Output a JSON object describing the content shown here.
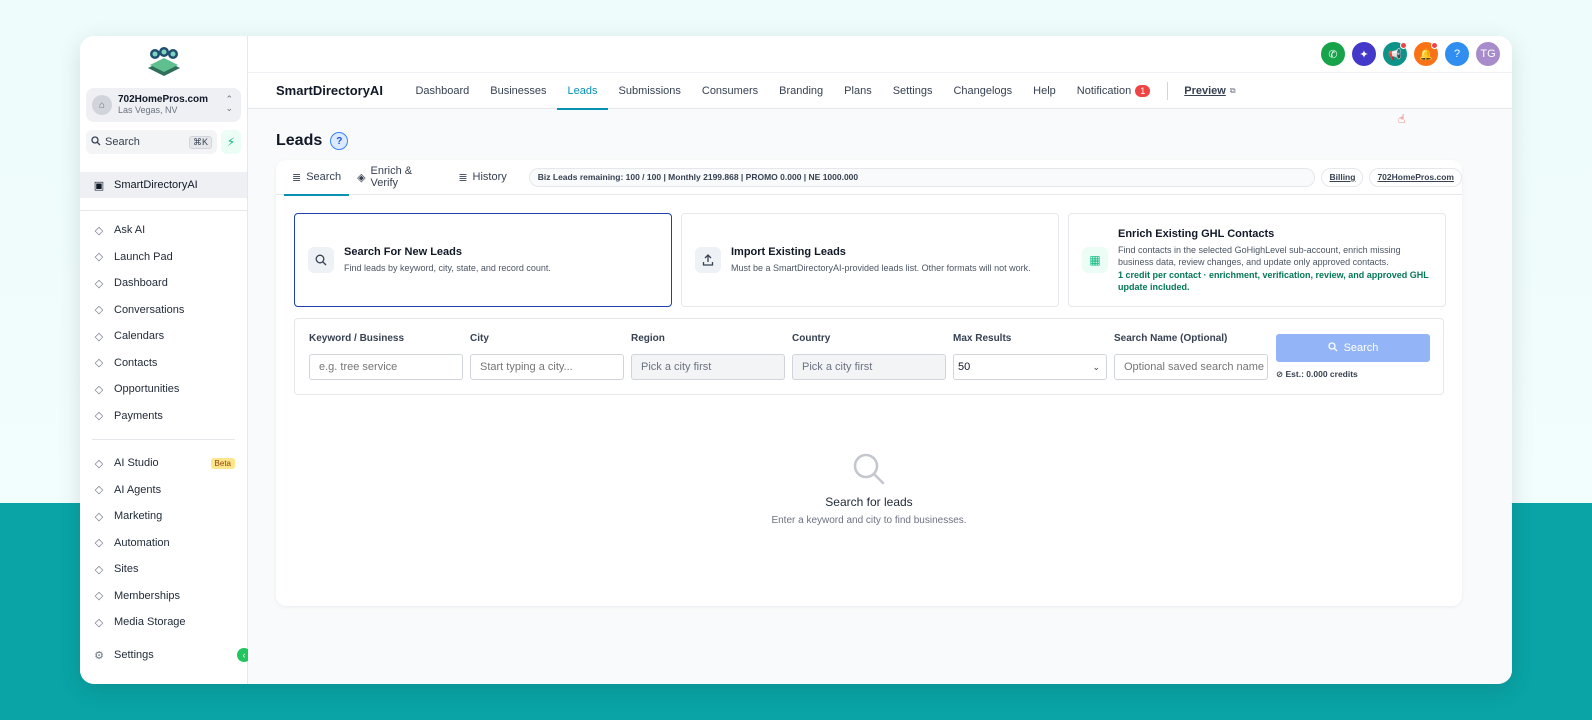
{
  "sidebar": {
    "account_name": "702HomePros.com",
    "account_location": "Las Vegas, NV",
    "search_label": "Search",
    "search_shortcut": "⌘K",
    "active_item": "SmartDirectoryAI",
    "items_primary": [
      {
        "label": "Ask AI",
        "icon": "sparkle-icon"
      },
      {
        "label": "Launch Pad",
        "icon": "rocket-icon"
      },
      {
        "label": "Dashboard",
        "icon": "grid-icon"
      },
      {
        "label": "Conversations",
        "icon": "chat-icon"
      },
      {
        "label": "Calendars",
        "icon": "calendar-icon"
      },
      {
        "label": "Contacts",
        "icon": "contacts-icon"
      },
      {
        "label": "Opportunities",
        "icon": "opportunities-icon"
      },
      {
        "label": "Payments",
        "icon": "payments-icon"
      }
    ],
    "items_secondary": [
      {
        "label": "AI Studio",
        "icon": "ai-studio-icon",
        "badge": "Beta"
      },
      {
        "label": "AI Agents",
        "icon": "ai-agents-icon"
      },
      {
        "label": "Marketing",
        "icon": "send-icon"
      },
      {
        "label": "Automation",
        "icon": "automation-icon"
      },
      {
        "label": "Sites",
        "icon": "sites-icon"
      },
      {
        "label": "Memberships",
        "icon": "membership-icon"
      },
      {
        "label": "Media Storage",
        "icon": "media-icon"
      }
    ],
    "settings_label": "Settings"
  },
  "topbar": {
    "avatar_initials": "TG",
    "colors": {
      "phone": "#16a34a",
      "ai": "#4338ca",
      "megaphone": "#0d9488",
      "bell": "#f97316",
      "help": "#2f8ef0",
      "avatar": "#a78bca"
    }
  },
  "nav": {
    "brand": "SmartDirectoryAI",
    "tabs": [
      "Dashboard",
      "Businesses",
      "Leads",
      "Submissions",
      "Consumers",
      "Branding",
      "Plans",
      "Settings",
      "Changelogs",
      "Help"
    ],
    "active_tab": "Leads",
    "notification_label": "Notification",
    "notification_count": "1",
    "preview_label": "Preview"
  },
  "page": {
    "title": "Leads",
    "help": "?"
  },
  "subtabs": {
    "search": "Search",
    "enrich": "Enrich & Verify",
    "history": "History",
    "quota": "Biz Leads remaining: 100 / 100 | Monthly 2199.868 | PROMO 0.000 | NE 1000.000",
    "billing": "Billing",
    "domain": "702HomePros.com"
  },
  "options": [
    {
      "title": "Search For New Leads",
      "desc": "Find leads by keyword, city, state, and record count."
    },
    {
      "title": "Import Existing Leads",
      "desc": "Must be a SmartDirectoryAI-provided leads list. Other formats will not work."
    },
    {
      "title": "Enrich Existing GHL Contacts",
      "desc": "Find contacts in the selected GoHighLevel sub-account, enrich missing business data, review changes, and update only approved contacts.",
      "note": "1 credit per contact · enrichment, verification, review, and approved GHL update included."
    }
  ],
  "form": {
    "keyword_label": "Keyword / Business",
    "keyword_placeholder": "e.g. tree service",
    "city_label": "City",
    "city_placeholder": "Start typing a city...",
    "region_label": "Region",
    "region_placeholder": "Pick a city first",
    "country_label": "Country",
    "country_placeholder": "Pick a city first",
    "max_label": "Max Results",
    "max_value": "50",
    "name_label": "Search Name (Optional)",
    "name_placeholder": "Optional saved search name",
    "search_button": "Search",
    "estimate": "Est.: 0.000 credits"
  },
  "empty": {
    "title": "Search for leads",
    "subtitle": "Enter a keyword and city to find businesses."
  }
}
